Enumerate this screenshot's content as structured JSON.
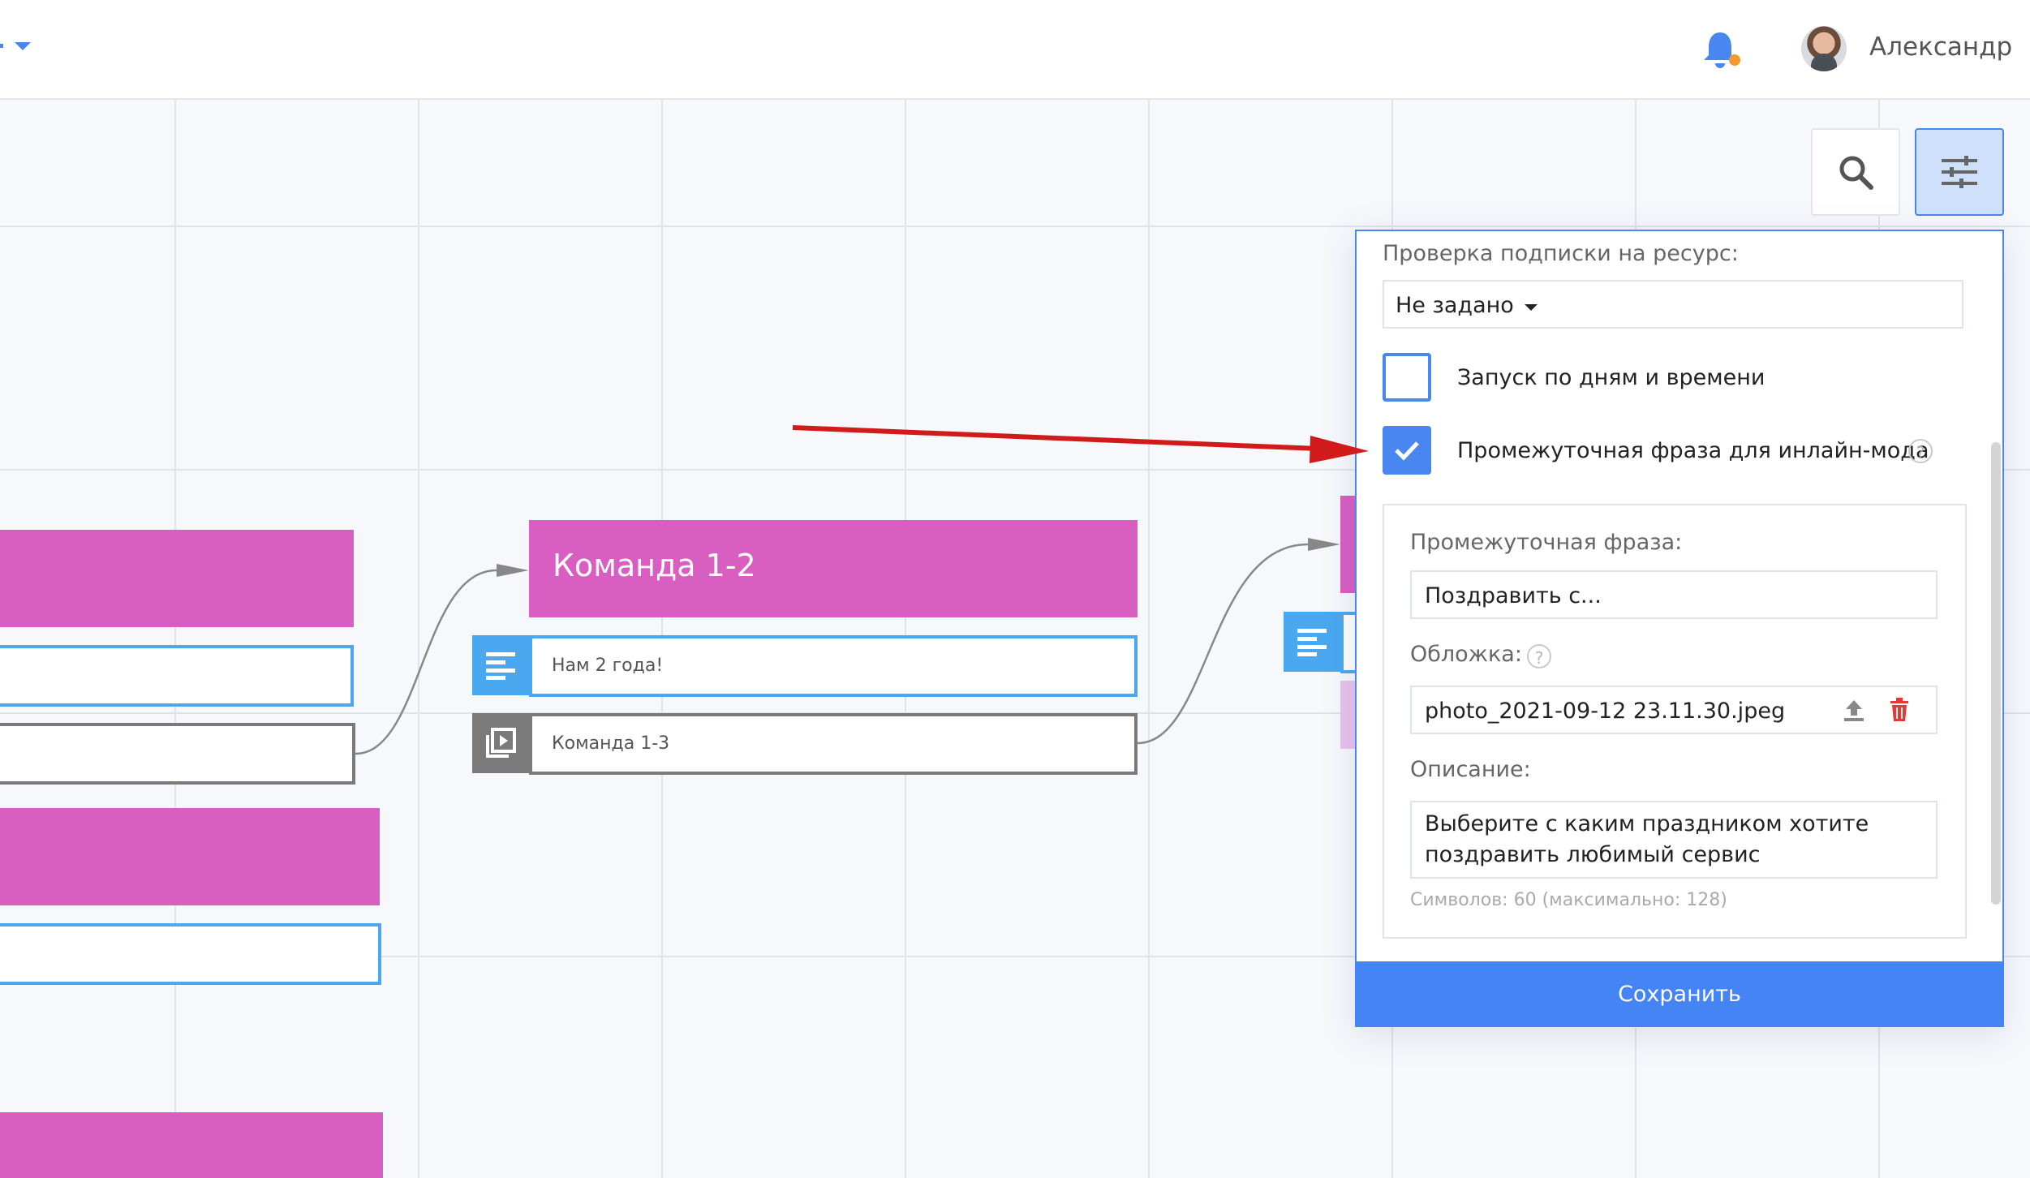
{
  "header": {
    "username": "Александр"
  },
  "canvas": {
    "blocks": [
      {
        "title": "Команда 1-2",
        "rows": [
          {
            "type": "text",
            "text": "Нам 2 года!"
          },
          {
            "type": "command",
            "text": "Команда 1-3"
          }
        ]
      }
    ]
  },
  "panel": {
    "subscription_label": "Проверка подписки на ресурс:",
    "subscription_value": "Не задано",
    "schedule_label": "Запуск по дням и времени",
    "schedule_checked": false,
    "inline_label": "Промежуточная фраза для инлайн-мода",
    "inline_checked": true,
    "inline": {
      "phrase_label": "Промежуточная фраза:",
      "phrase_value": "Поздравить с...",
      "cover_label": "Обложка:",
      "cover_value": "photo_2021-09-12 23.11.30.jpeg",
      "description_label": "Описание:",
      "description_value": "Выберите с каким праздником хотите поздравить любимый сервис",
      "counter": "Символов: 60 (максимально: 128)"
    },
    "save_label": "Сохранить"
  },
  "colors": {
    "accent": "#4584f4",
    "command_block": "#d95ec2",
    "text_row": "#4aa8f0",
    "annotation_arrow": "#d11a1a"
  },
  "icons": [
    "chevron-down-icon",
    "bell-icon",
    "search-icon",
    "sliders-icon",
    "text-lines-icon",
    "command-icon",
    "checkmark-icon",
    "help-icon",
    "upload-icon",
    "trash-icon",
    "arrow-icon"
  ]
}
